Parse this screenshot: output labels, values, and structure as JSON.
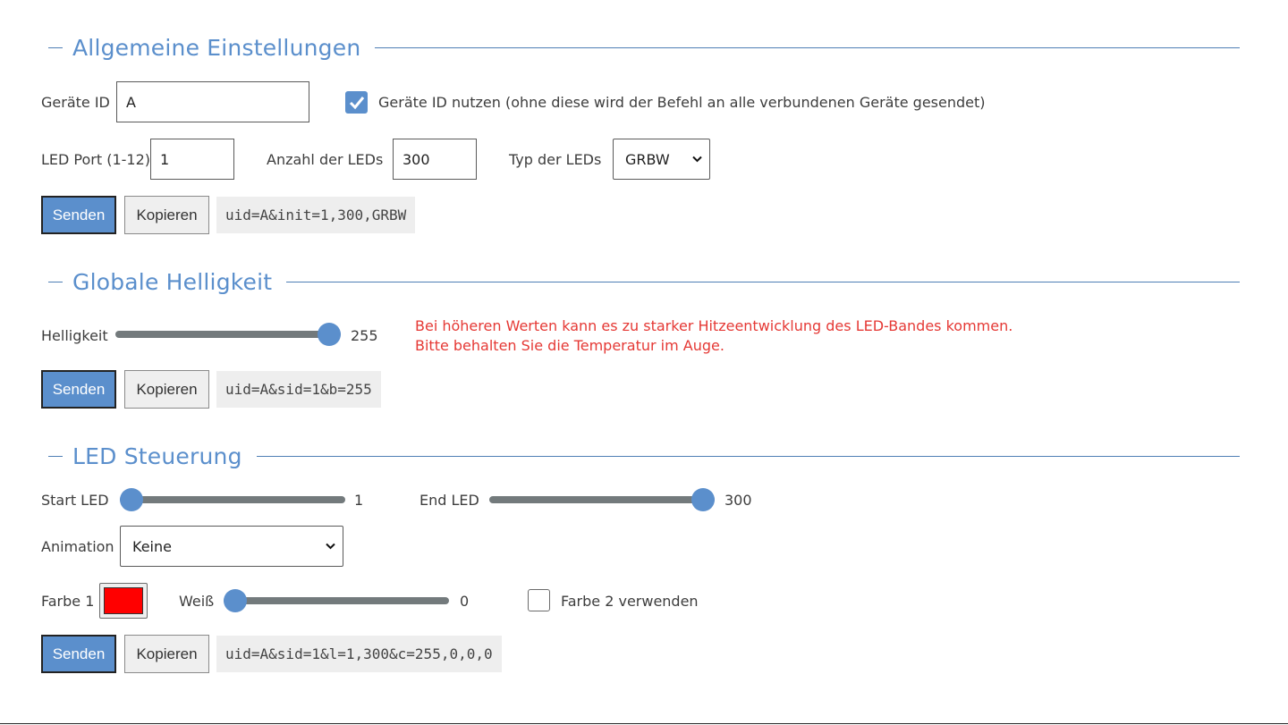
{
  "sections": {
    "general": {
      "title": "Allgemeine Einstellungen",
      "device_id_label": "Geräte ID",
      "device_id_value": "A",
      "use_device_id_checked": true,
      "use_device_id_label": "Geräte ID nutzen (ohne diese wird der Befehl an alle verbundenen Geräte gesendet)",
      "led_port_label": "LED Port (1-12)",
      "led_port_value": "1",
      "led_count_label": "Anzahl der LEDs",
      "led_count_value": "300",
      "led_type_label": "Typ der LEDs",
      "led_type_value": "GRBW",
      "send_label": "Senden",
      "copy_label": "Kopieren",
      "command": "uid=A&init=1,300,GRBW"
    },
    "brightness": {
      "title": "Globale Helligkeit",
      "brightness_label": "Helligkeit",
      "brightness_value": "255",
      "brightness_max": 255,
      "warning_line1": "Bei höheren Werten kann es zu starker Hitzeentwicklung des LED-Bandes kommen.",
      "warning_line2": "Bitte behalten Sie die Temperatur im Auge.",
      "warning_color": "#e53935",
      "send_label": "Senden",
      "copy_label": "Kopieren",
      "command": "uid=A&sid=1&b=255"
    },
    "control": {
      "title": "LED Steuerung",
      "start_label": "Start LED",
      "start_value": "1",
      "end_label": "End LED",
      "end_value": "300",
      "animation_label": "Animation",
      "animation_value": "Keine",
      "color1_label": "Farbe 1",
      "color1_value": "#ff0000",
      "white_label": "Weiß",
      "white_value": "0",
      "color2_checked": false,
      "color2_label": "Farbe 2 verwenden",
      "send_label": "Senden",
      "copy_label": "Kopieren",
      "command": "uid=A&sid=1&l=1,300&c=255,0,0,0"
    }
  },
  "colors": {
    "accent": "#5b8fcc",
    "slider_track": "#737a7c"
  },
  "icons": {
    "checkmark": "check-icon",
    "dropdown": "chevron-down-icon"
  }
}
